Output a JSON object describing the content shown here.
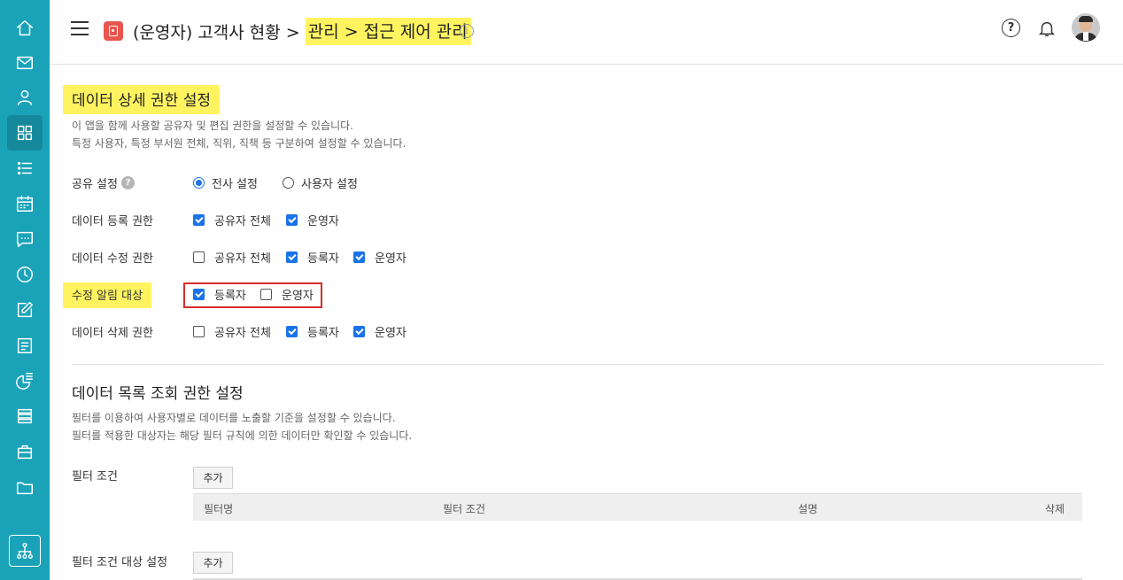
{
  "header": {
    "breadcrumb_prefix": "(운영자) 고객사 현황 > ",
    "breadcrumb_highlight": "관리 > 접근 제어 관리",
    "info_glyph": "i",
    "help_glyph": "?"
  },
  "sidebar": {
    "items": [
      "home-icon",
      "mail-icon",
      "user-icon",
      "grid-icon",
      "list-icon",
      "calendar-icon",
      "chat-icon",
      "clock-icon",
      "edit-icon",
      "board-icon",
      "chart-icon",
      "stack-icon",
      "briefcase-icon",
      "folder-icon"
    ],
    "active": "grid-icon",
    "bottom": "org-chart-icon"
  },
  "detail_section": {
    "title": "데이터 상세 권한 설정",
    "desc_line1": "이 앱을 함께 사용할 공유자 및 편집 권한을 설정할 수 있습니다.",
    "desc_line2": "특정 사용자, 특정 부서원 전체, 직위, 직책 등 구분하여 설정할 수 있습니다.",
    "share_label": "공유 설정",
    "share_help_glyph": "?",
    "share_options": [
      {
        "label": "전사 설정",
        "selected": true
      },
      {
        "label": "사용자 설정",
        "selected": false
      }
    ],
    "register_label": "데이터 등록 권한",
    "register_options": [
      {
        "label": "공유자 전체",
        "checked": true
      },
      {
        "label": "운영자",
        "checked": true
      }
    ],
    "edit_label": "데이터 수정 권한",
    "edit_options": [
      {
        "label": "공유자 전체",
        "checked": false
      },
      {
        "label": "등록자",
        "checked": true
      },
      {
        "label": "운영자",
        "checked": true
      }
    ],
    "notify_label": "수정 알림 대상",
    "notify_options": [
      {
        "label": "등록자",
        "checked": true
      },
      {
        "label": "운영자",
        "checked": false
      }
    ],
    "delete_label": "데이터 삭제 권한",
    "delete_options": [
      {
        "label": "공유자 전체",
        "checked": false
      },
      {
        "label": "등록자",
        "checked": true
      },
      {
        "label": "운영자",
        "checked": true
      }
    ]
  },
  "list_section": {
    "title": "데이터 목록 조회 권한 설정",
    "desc_line1": "필터를 이용하여 사용자별로 데이터를 노출할 기준을 설정할 수 있습니다.",
    "desc_line2": "필터를 적용한 대상자는 해당 필터 규칙에 의한 데이터만 확인할 수 있습니다.",
    "filter_label": "필터 조건",
    "add_label": "추가",
    "columns": [
      "필터명",
      "필터 조건",
      "설명",
      "삭제"
    ],
    "target_label": "필터 조건 대상 설정",
    "target_add_label": "추가"
  },
  "colors": {
    "sidebar": "#1aa3b8",
    "highlight": "#fff460",
    "checkbox": "#1a73e8",
    "red_box": "#d92b2b"
  }
}
